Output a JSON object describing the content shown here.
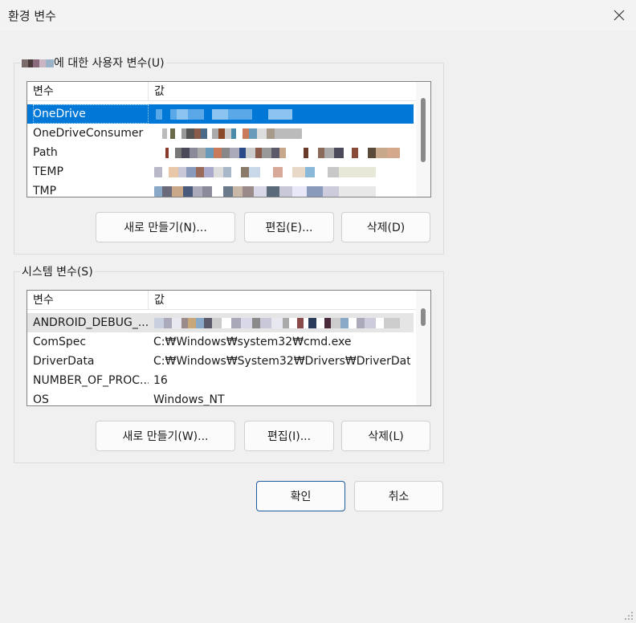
{
  "window": {
    "title": "환경 변수",
    "close_label": "×"
  },
  "user_vars": {
    "legend": "에 대한 사용자 변수(U)",
    "col_name": "변수",
    "col_value": "값",
    "rows": [
      {
        "name": "OneDrive",
        "value": ""
      },
      {
        "name": "OneDriveConsumer",
        "value": ""
      },
      {
        "name": "Path",
        "value": ""
      },
      {
        "name": "TEMP",
        "value": ""
      },
      {
        "name": "TMP",
        "value": ""
      }
    ],
    "new_button": "새로 만들기(N)...",
    "edit_button": "편집(E)...",
    "delete_button": "삭제(D)"
  },
  "system_vars": {
    "legend": "시스템 변수(S)",
    "col_name": "변수",
    "col_value": "값",
    "rows": [
      {
        "name": "ANDROID_DEBUG_...",
        "value": ""
      },
      {
        "name": "ComSpec",
        "value": "C:₩Windows₩system32₩cmd.exe"
      },
      {
        "name": "DriverData",
        "value": "C:₩Windows₩System32₩Drivers₩DriverData"
      },
      {
        "name": "NUMBER_OF_PROC...",
        "value": "16"
      },
      {
        "name": "OS",
        "value": "Windows_NT"
      }
    ],
    "new_button": "새로 만들기(W)...",
    "edit_button": "편집(I)...",
    "delete_button": "삭제(L)"
  },
  "footer": {
    "ok_button": "확인",
    "cancel_button": "취소"
  },
  "colors": {
    "selection": "#0078d7",
    "default_button_border": "#1f5c9e",
    "background": "#f0f0f0"
  },
  "icons": [
    "close-icon",
    "resize-grip-icon"
  ]
}
